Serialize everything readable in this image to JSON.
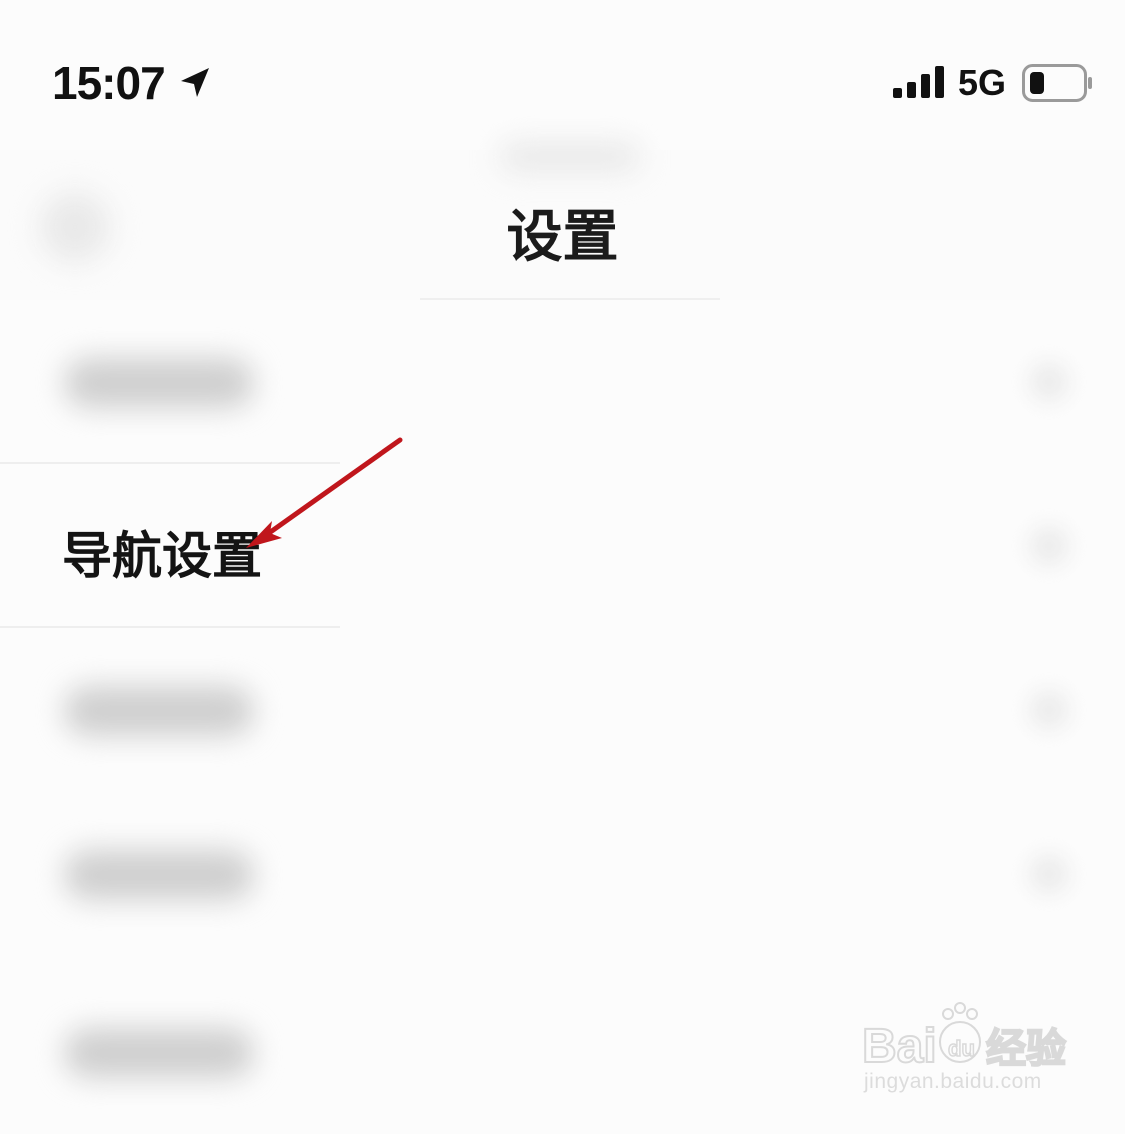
{
  "status_bar": {
    "time": "15:07",
    "network": "5G",
    "location_icon": "location-arrow-icon",
    "signal_icon": "cellular-signal-icon",
    "battery_icon": "battery-low-icon"
  },
  "nav": {
    "title": "设置",
    "back_icon": "back-arrow-icon"
  },
  "settings_list": {
    "highlighted_item": "导航设置"
  },
  "annotation": {
    "color": "#c0161c"
  },
  "watermark": {
    "logo_text": "Baidu经验",
    "url": "jingyan.baidu.com"
  }
}
